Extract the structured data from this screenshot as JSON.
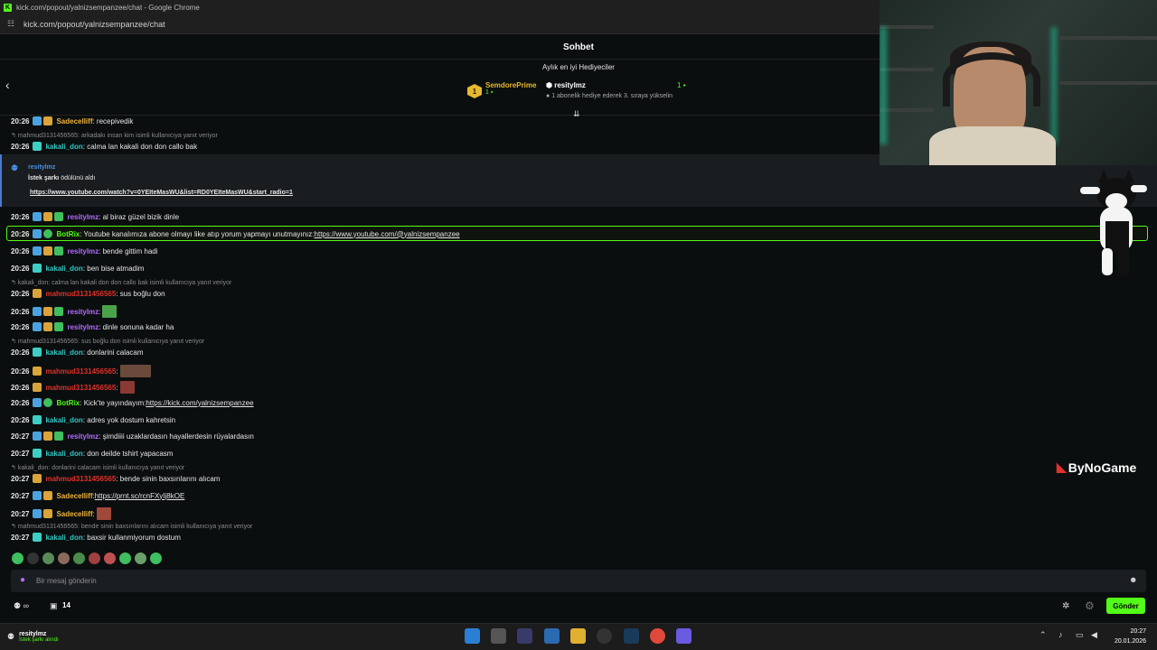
{
  "window": {
    "title": "kick.com/popout/yalnizsempanzee/chat - Google Chrome",
    "url": "kick.com/popout/yalnizsempanzee/chat"
  },
  "chat": {
    "title": "Sohbet",
    "gifters_title": "Aylık en iyi Hediyeciler",
    "gifter1": {
      "rank": "1",
      "name": "SemdorePrime",
      "count": "1"
    },
    "gifter2": {
      "name": "resitylmz",
      "sub": "1 abonelik hediye ederek 3. sıraya yükselin",
      "count": "1"
    }
  },
  "messages": [
    {
      "time": "20:26",
      "user": "Sadecelliff",
      "text": ": recepivedik"
    },
    {
      "reply": "mahmud3131456565: arkadakı insan kim isimli kullanıcıya yanıt veriyor"
    },
    {
      "time": "20:26",
      "user": "kakali_don",
      "text": ": calma lan kakali don don callo bak"
    },
    {
      "time": "20:26",
      "user": "resitylmz",
      "text": ": al biraz güzel bizik dinle"
    },
    {
      "time": "20:26",
      "user": "BotRix",
      "text": ": Youtube kanalımıza abone olmayı like atıp yorum yapmayı unutmayınız: ",
      "link": "https://www.youtube.com/@yalnizsempanzee"
    },
    {
      "time": "20:26",
      "user": "resitylmz",
      "text": ": bende gittim hadi"
    },
    {
      "time": "20:26",
      "user": "kakali_don",
      "text": ": ben bise atmadim"
    },
    {
      "reply": "kakali_don: calma lan kakali don don callo bak isimli kullanıcıya yanıt veriyor"
    },
    {
      "time": "20:26",
      "user": "mahmud3131456565",
      "text": ": sus boğlu don"
    },
    {
      "time": "20:26",
      "user": "resitylmz",
      "text": ":"
    },
    {
      "time": "20:26",
      "user": "resitylmz",
      "text": ": dinle sonuna kadar ha"
    },
    {
      "reply": "mahmud3131456565: sus boğlu don isimli kullanıcıya yanıt veriyor"
    },
    {
      "time": "20:26",
      "user": "kakali_don",
      "text": ": donlarini calacam"
    },
    {
      "time": "20:26",
      "user": "mahmud3131456565",
      "text": ":"
    },
    {
      "time": "20:26",
      "user": "mahmud3131456565",
      "text": ":"
    },
    {
      "time": "20:26",
      "user": "BotRix",
      "text": ": Kick'te yayındayım: ",
      "link": "https://kick.com/yalnizsempanzee"
    },
    {
      "time": "20:26",
      "user": "kakali_don",
      "text": ": adres yok dostum kahretsin"
    },
    {
      "time": "20:27",
      "user": "resitylmz",
      "text": ": şimdiiii uzaklardasın hayallerdesin rüyalardasın"
    },
    {
      "time": "20:27",
      "user": "kakali_don",
      "text": ": don deilde tshirt yapacasm"
    },
    {
      "reply": "kakali_don: donlarini calacam isimli kullanıcıya yanıt veriyor"
    },
    {
      "time": "20:27",
      "user": "mahmud3131456565",
      "text": ": bende sinin baxsırılarını alıcam"
    },
    {
      "time": "20:27",
      "user": "Sadecelliff",
      "text": ": ",
      "link": "https://prnt.sc/rcnFXyIj8kOE"
    },
    {
      "time": "20:27",
      "user": "Sadecelliff",
      "text": ":"
    },
    {
      "reply": "mahmud3131456565: bende sinin baxsırılarını alıcam isimli kullanıcıya yanıt veriyor"
    },
    {
      "time": "20:27",
      "user": "kakali_don",
      "text": ": baxsir kullanmiyorum dostum"
    }
  ],
  "highlight": {
    "user": "resitylmz",
    "title_bold": "İstek şarkı",
    "title_rest": " ödülünü aldı",
    "link": "https://www.youtube.com/watch?v=0YEIteMasWU&list=RD0YEIteMasWU&start_radio=1"
  },
  "input": {
    "placeholder": "Bir mesaj gönderin",
    "send_label": "Gönder"
  },
  "footer": {
    "infinity": "∞",
    "count": "14"
  },
  "overlay": {
    "brand": "ByNoGame"
  },
  "taskbar": {
    "user": "resitylmz",
    "sub": "İstek şarkı alındı",
    "time": "20:27",
    "date": "20.01.2026"
  },
  "colors": {
    "kick_green": "#53fc18",
    "purple": "#b36bff",
    "teal": "#33c6c3",
    "red": "#e0312b",
    "gold": "#f0b43a"
  }
}
